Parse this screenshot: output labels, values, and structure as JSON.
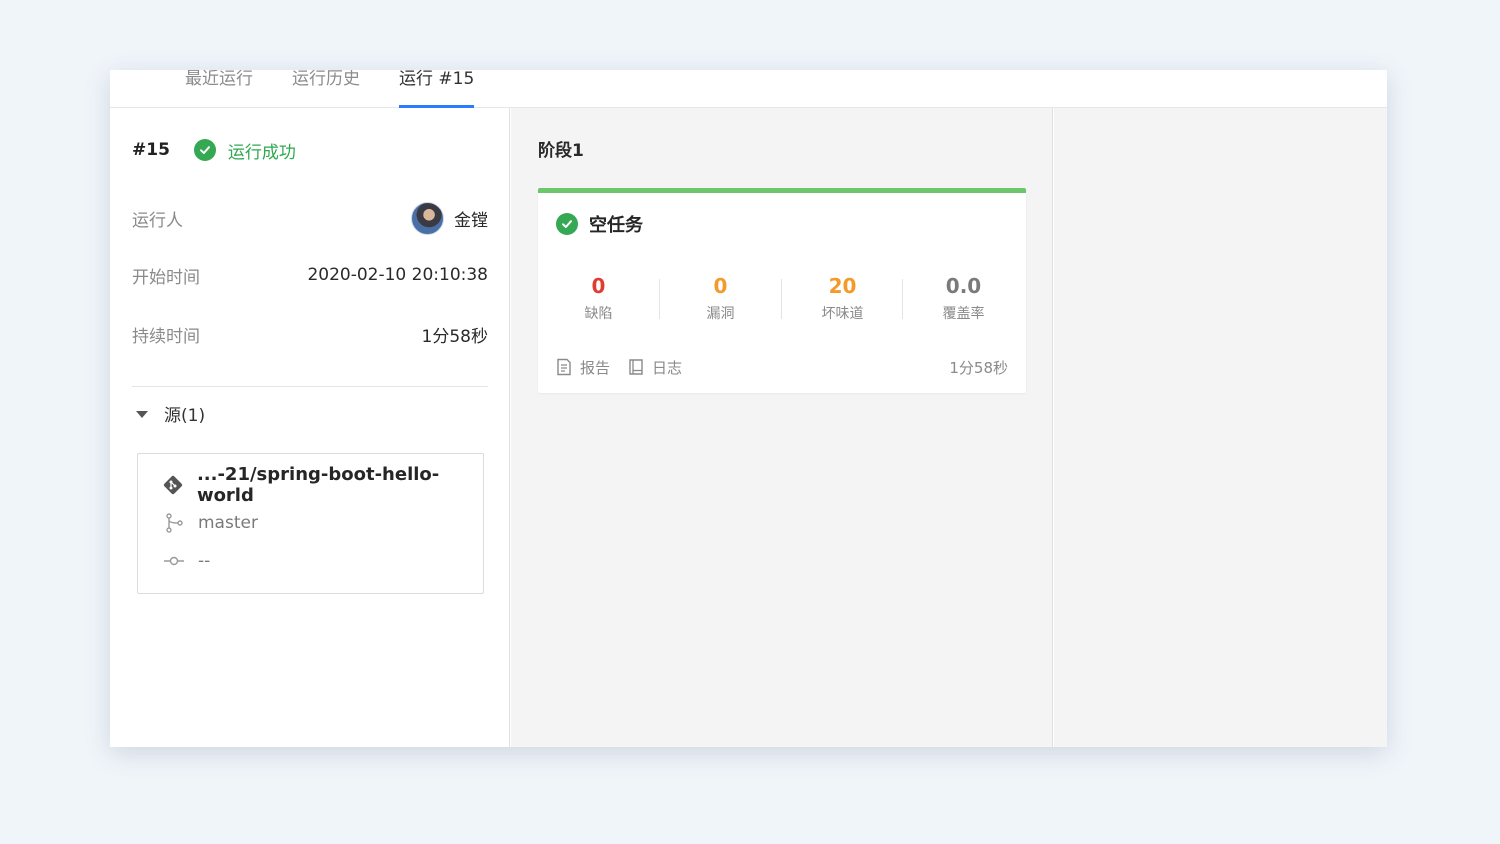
{
  "tabs": [
    {
      "label": "最近运行"
    },
    {
      "label": "运行历史"
    },
    {
      "label": "运行 #15",
      "active": true
    }
  ],
  "run": {
    "number": "#15",
    "status": "运行成功",
    "status_color": "#2fa84f",
    "info": [
      {
        "key": "运行人",
        "value": "金镗"
      },
      {
        "key": "开始时间",
        "value": "2020-02-10 20:10:38"
      },
      {
        "key": "持续时间",
        "value": "1分58秒"
      }
    ]
  },
  "sources": {
    "header": "源(1)",
    "items": [
      {
        "repo": "...-21/spring-boot-hello-world",
        "branch": "master",
        "commit": "--"
      }
    ]
  },
  "stage": {
    "title": "阶段1",
    "jobs": [
      {
        "name": "空任务",
        "status": "success",
        "metrics": [
          {
            "value": "0",
            "label": "缺陷",
            "color": "#e03c31"
          },
          {
            "value": "0",
            "label": "漏洞",
            "color": "#f39a2b"
          },
          {
            "value": "20",
            "label": "坏味道",
            "color": "#f39a2b"
          },
          {
            "value": "0.0",
            "label": "覆盖率",
            "color": "#7a7a7a"
          }
        ],
        "report_label": "报告",
        "log_label": "日志",
        "duration": "1分58秒"
      }
    ]
  },
  "colors": {
    "accent": "#2a7cff",
    "success": "#34a853",
    "stage_bar": "#6cc76c"
  }
}
